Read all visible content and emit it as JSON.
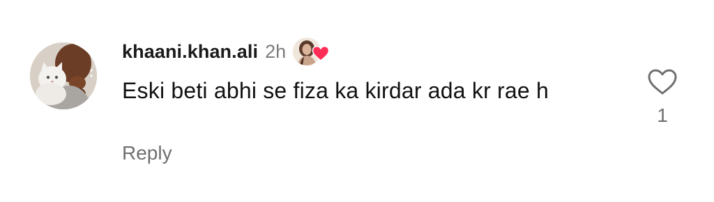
{
  "comment": {
    "username": "khaani.khan.ali",
    "time": "2h",
    "text": "Eski beti abhi se fiza ka kirdar ada kr rae h",
    "reply_label": "Reply",
    "like_count": "1",
    "liked_by_creator": true,
    "icons": {
      "like": "heart-outline-icon",
      "creator_like": "heart-filled-icon"
    }
  },
  "colors": {
    "username": "#1a1a1a",
    "muted": "#7b7b7b",
    "heart_red": "#ff2d55",
    "icon_stroke": "#6f6f6f"
  }
}
